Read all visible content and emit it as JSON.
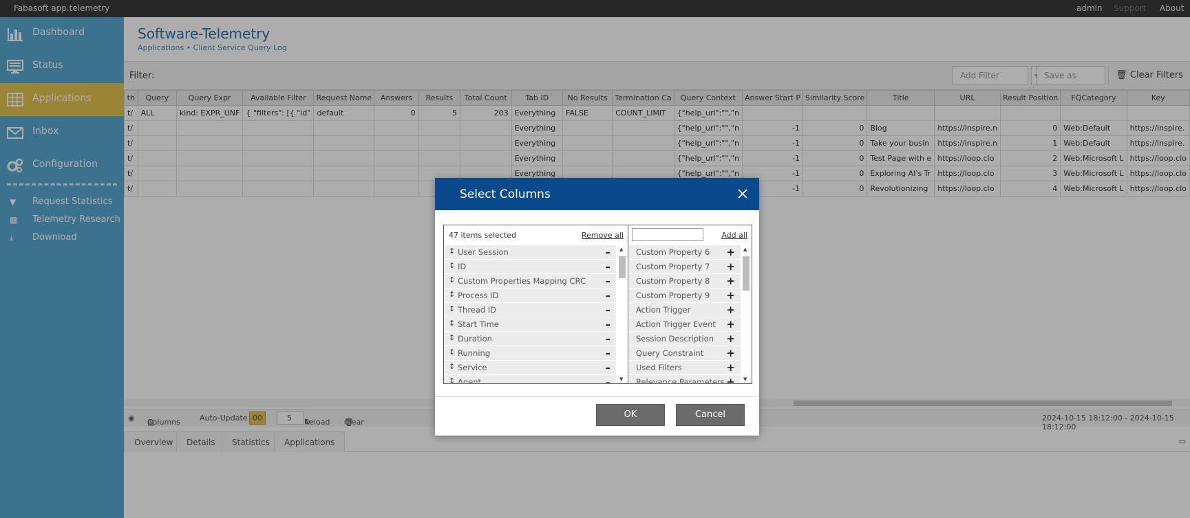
{
  "topbar": {
    "app_title": "Fabasoft app.telemetry",
    "links": [
      "admin",
      "Support",
      "About"
    ]
  },
  "sidebar": {
    "items": [
      {
        "label": "Dashboard",
        "icon": "bar-chart-icon"
      },
      {
        "label": "Status",
        "icon": "monitor-icon"
      },
      {
        "label": "Applications",
        "icon": "grid-icon"
      },
      {
        "label": "Inbox",
        "icon": "envelope-icon"
      },
      {
        "label": "Configuration",
        "icon": "gears-icon"
      }
    ],
    "subitems": [
      {
        "label": "Request Statistics",
        "icon": "funnel-icon"
      },
      {
        "label": "Telemetry Research",
        "icon": "table-icon"
      },
      {
        "label": "Download",
        "icon": "download-icon"
      }
    ]
  },
  "page": {
    "title": "Software-Telemetry",
    "breadcrumb": "Applications  •  Client Service Query Log",
    "filter_label": "Filter:",
    "add_filter": "Add Filter",
    "save_as": "Save as",
    "clear_filters": "Clear Filters"
  },
  "table": {
    "columns": [
      "th",
      "Query",
      "Query Expr",
      "Available Filter",
      "Request Name",
      "Answers",
      "Results",
      "Total Count",
      "Tab ID",
      "No Results",
      "Termination Ca",
      "Query Context",
      "Answer Start P",
      "Similarity Score",
      "Title",
      "URL",
      "Result Position",
      "FQCategory",
      "Key"
    ],
    "rows": [
      [
        "t/",
        "ALL",
        "kind: EXPR_UNF",
        "{ \"filters\": [{ \"id\"",
        "default",
        "0",
        "5",
        "203",
        "Everything",
        "FALSE",
        "COUNT_LIMIT",
        "{\"help_url\":\"\",\"n",
        "",
        "",
        "",
        "",
        "",
        "",
        ""
      ],
      [
        "t/",
        "",
        "",
        "",
        "",
        "",
        "",
        "",
        "Everything",
        "",
        "",
        "{\"help_url\":\"\",\"n",
        "-1",
        "0",
        "Blog",
        "https://inspire.n",
        "0",
        "Web:Default",
        "https://inspire."
      ],
      [
        "t/",
        "",
        "",
        "",
        "",
        "",
        "",
        "",
        "Everything",
        "",
        "",
        "{\"help_url\":\"\",\"n",
        "-1",
        "0",
        "Take your busin",
        "https://inspire.n",
        "1",
        "Web:Default",
        "https://inspire."
      ],
      [
        "t/",
        "",
        "",
        "",
        "",
        "",
        "",
        "",
        "Everything",
        "",
        "",
        "{\"help_url\":\"\",\"n",
        "-1",
        "0",
        "Test Page with e",
        "https://loop.clo",
        "2",
        "Web:Microsoft L",
        "https://loop.clo"
      ],
      [
        "t/",
        "",
        "",
        "",
        "",
        "",
        "",
        "",
        "Everything",
        "",
        "",
        "{\"help_url\":\"\",\"n",
        "-1",
        "0",
        "Exploring AI's Tr",
        "https://loop.clo",
        "3",
        "Web:Microsoft L",
        "https://loop.clo"
      ],
      [
        "t/",
        "",
        "",
        "",
        "",
        "",
        "",
        "",
        "Everything",
        "",
        "",
        "{\"help_url\":\"\",\"n",
        "-1",
        "0",
        "Revolutionizing",
        "https://loop.clo",
        "4",
        "Web:Microsoft L",
        "https://loop.clo"
      ]
    ]
  },
  "toolbar": {
    "columns": "Columns",
    "auto_update": "Auto-Update",
    "auto_update_value": "00",
    "interval": "5",
    "reload": "Reload",
    "clear": "Clear",
    "time_range": "2024-10-15 18:12:00 - 2024-10-15 18:12:00"
  },
  "bottom_tabs": [
    "Overview",
    "Details",
    "Statistics",
    "Applications"
  ],
  "dialog": {
    "title": "Select Columns",
    "selected_count": "47 items selected",
    "remove_all": "Remove all",
    "add_all": "Add all",
    "search_placeholder": "",
    "selected_items": [
      "User Session",
      "ID",
      "Custom Properties Mapping CRC",
      "Process ID",
      "Thread ID",
      "Start Time",
      "Duration",
      "Running",
      "Service",
      "Agent"
    ],
    "available_items": [
      "Custom Property 6",
      "Custom Property 7",
      "Custom Property 8",
      "Custom Property 9",
      "Action Trigger",
      "Action Trigger Event",
      "Session Description",
      "Query Constraint",
      "Used Filters",
      "Relevance Parameters"
    ],
    "ok": "OK",
    "cancel": "Cancel"
  }
}
